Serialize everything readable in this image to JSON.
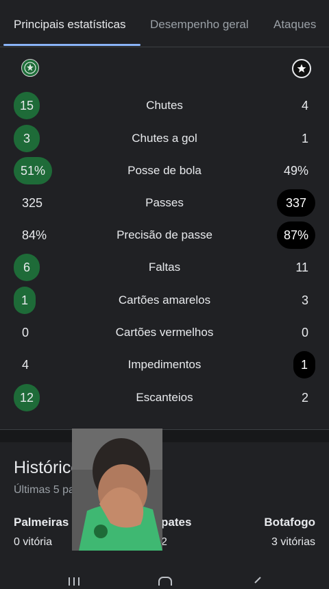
{
  "tabs": [
    {
      "label": "Principais estatísticas",
      "active": true
    },
    {
      "label": "Desempenho geral",
      "active": false
    },
    {
      "label": "Ataques",
      "active": false
    }
  ],
  "teams": {
    "home": {
      "icon": "palmeiras-crest-icon",
      "color": "#1e6b38"
    },
    "away": {
      "icon": "botafogo-star-crest-icon",
      "color": "#000000"
    }
  },
  "stats": [
    {
      "label": "Chutes",
      "home": "15",
      "away": "4"
    },
    {
      "label": "Chutes a gol",
      "home": "3",
      "away": "1"
    },
    {
      "label": "Posse de bola",
      "home": "51%",
      "away": "49%"
    },
    {
      "label": "Passes",
      "home": "325",
      "away": "337"
    },
    {
      "label": "Precisão de passe",
      "home": "84%",
      "away": "87%"
    },
    {
      "label": "Faltas",
      "home": "6",
      "away": "11"
    },
    {
      "label": "Cartões amarelos",
      "home": "1",
      "away": "3"
    },
    {
      "label": "Cartões vermelhos",
      "home": "0",
      "away": "0"
    },
    {
      "label": "Impedimentos",
      "home": "4",
      "away": "1"
    },
    {
      "label": "Escanteios",
      "home": "12",
      "away": "2"
    }
  ],
  "history": {
    "title": "Histórico",
    "subtitle": "Últimas 5 partid",
    "columns": [
      {
        "name": "Palmeiras",
        "value": "0 vitória"
      },
      {
        "name": "pates",
        "value": "2"
      },
      {
        "name": "Botafogo",
        "value": "3 vitórias"
      }
    ]
  },
  "navbar": {
    "icons": [
      "recent-apps-icon",
      "home-icon",
      "back-icon"
    ]
  }
}
